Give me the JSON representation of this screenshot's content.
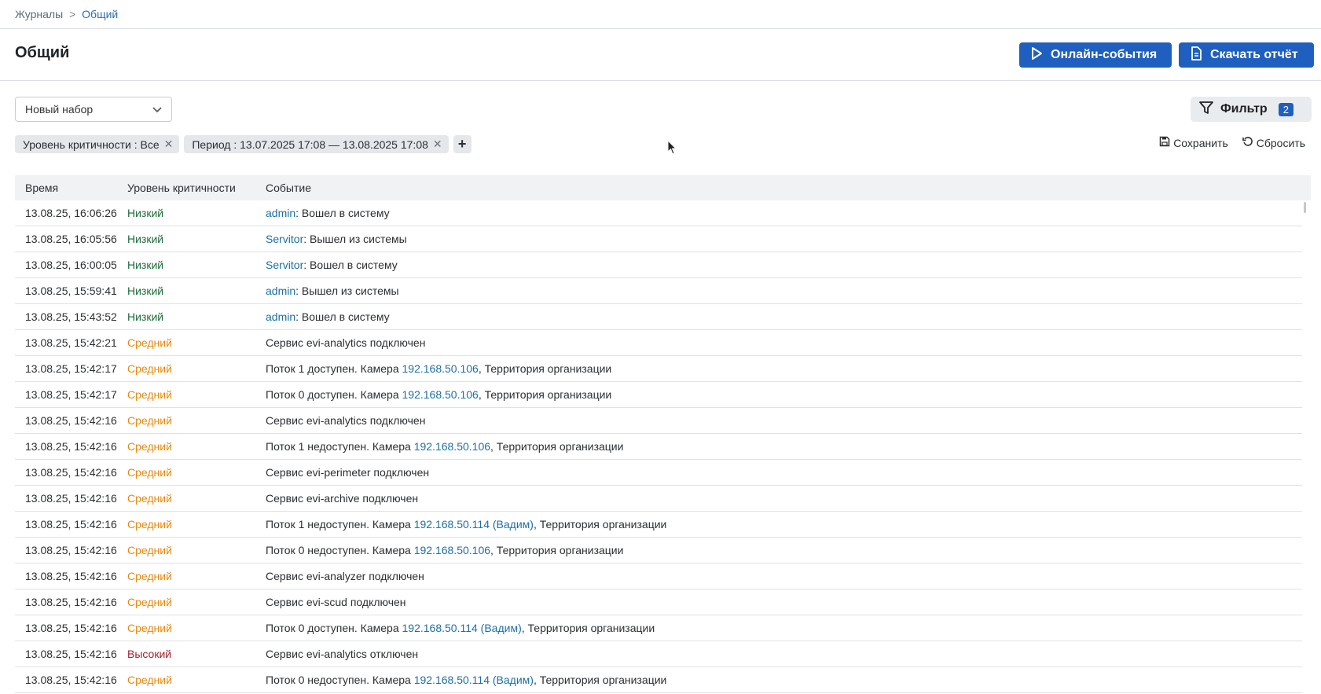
{
  "breadcrumb": {
    "root": "Журналы",
    "separator": ">",
    "current": "Общий"
  },
  "page": {
    "title": "Общий"
  },
  "toolbar": {
    "online_label": "Онлайн-события",
    "report_label": "Скачать отчёт"
  },
  "preset": {
    "value": "Новый набор"
  },
  "filter": {
    "label": "Фильтр",
    "count": "2"
  },
  "chips": [
    {
      "label": "Уровень критичности : Все"
    },
    {
      "label": "Период : 13.07.2025 17:08 — 13.08.2025 17:08"
    }
  ],
  "chip_add": "+",
  "chip_remove": "✕",
  "actions": {
    "save_label": "Сохранить",
    "reset_label": "Сбросить"
  },
  "table": {
    "headers": {
      "time": "Время",
      "level": "Уровень критичности",
      "event": "Событие"
    },
    "rows": [
      {
        "time": "13.08.25, 16:06:26",
        "level": "Низкий",
        "severity": "low",
        "event": [
          {
            "t": "admin",
            "link": true
          },
          {
            "t": ": Вошел в систему"
          }
        ]
      },
      {
        "time": "13.08.25, 16:05:56",
        "level": "Низкий",
        "severity": "low",
        "event": [
          {
            "t": "Servitor",
            "link": true
          },
          {
            "t": ": Вышел из системы"
          }
        ]
      },
      {
        "time": "13.08.25, 16:00:05",
        "level": "Низкий",
        "severity": "low",
        "event": [
          {
            "t": "Servitor",
            "link": true
          },
          {
            "t": ": Вошел в систему"
          }
        ]
      },
      {
        "time": "13.08.25, 15:59:41",
        "level": "Низкий",
        "severity": "low",
        "event": [
          {
            "t": "admin",
            "link": true
          },
          {
            "t": ": Вышел из системы"
          }
        ]
      },
      {
        "time": "13.08.25, 15:43:52",
        "level": "Низкий",
        "severity": "low",
        "event": [
          {
            "t": "admin",
            "link": true
          },
          {
            "t": ": Вошел в систему"
          }
        ]
      },
      {
        "time": "13.08.25, 15:42:21",
        "level": "Средний",
        "severity": "mid",
        "event": [
          {
            "t": "Сервис evi-analytics подключен"
          }
        ]
      },
      {
        "time": "13.08.25, 15:42:17",
        "level": "Средний",
        "severity": "mid",
        "event": [
          {
            "t": "Поток 1 доступен. Камера "
          },
          {
            "t": "192.168.50.106",
            "link": true
          },
          {
            "t": ", Территория организации"
          }
        ]
      },
      {
        "time": "13.08.25, 15:42:17",
        "level": "Средний",
        "severity": "mid",
        "event": [
          {
            "t": "Поток 0 доступен. Камера "
          },
          {
            "t": "192.168.50.106",
            "link": true
          },
          {
            "t": ", Территория организации"
          }
        ]
      },
      {
        "time": "13.08.25, 15:42:16",
        "level": "Средний",
        "severity": "mid",
        "event": [
          {
            "t": "Сервис evi-analytics подключен"
          }
        ]
      },
      {
        "time": "13.08.25, 15:42:16",
        "level": "Средний",
        "severity": "mid",
        "event": [
          {
            "t": "Поток 1 недоступен. Камера "
          },
          {
            "t": "192.168.50.106",
            "link": true
          },
          {
            "t": ", Территория организации"
          }
        ]
      },
      {
        "time": "13.08.25, 15:42:16",
        "level": "Средний",
        "severity": "mid",
        "event": [
          {
            "t": "Сервис evi-perimeter подключен"
          }
        ]
      },
      {
        "time": "13.08.25, 15:42:16",
        "level": "Средний",
        "severity": "mid",
        "event": [
          {
            "t": "Сервис evi-archive подключен"
          }
        ]
      },
      {
        "time": "13.08.25, 15:42:16",
        "level": "Средний",
        "severity": "mid",
        "event": [
          {
            "t": "Поток 1 недоступен. Камера "
          },
          {
            "t": "192.168.50.114 (Вадим)",
            "link": true
          },
          {
            "t": ", Территория организации"
          }
        ]
      },
      {
        "time": "13.08.25, 15:42:16",
        "level": "Средний",
        "severity": "mid",
        "event": [
          {
            "t": "Поток 0 недоступен. Камера "
          },
          {
            "t": "192.168.50.106",
            "link": true
          },
          {
            "t": ", Территория организации"
          }
        ]
      },
      {
        "time": "13.08.25, 15:42:16",
        "level": "Средний",
        "severity": "mid",
        "event": [
          {
            "t": "Сервис evi-analyzer подключен"
          }
        ]
      },
      {
        "time": "13.08.25, 15:42:16",
        "level": "Средний",
        "severity": "mid",
        "event": [
          {
            "t": "Сервис evi-scud подключен"
          }
        ]
      },
      {
        "time": "13.08.25, 15:42:16",
        "level": "Средний",
        "severity": "mid",
        "event": [
          {
            "t": "Поток 0 доступен. Камера "
          },
          {
            "t": "192.168.50.114 (Вадим)",
            "link": true
          },
          {
            "t": ", Территория организации"
          }
        ]
      },
      {
        "time": "13.08.25, 15:42:16",
        "level": "Высокий",
        "severity": "high",
        "event": [
          {
            "t": "Сервис evi-analytics отключен"
          }
        ]
      },
      {
        "time": "13.08.25, 15:42:16",
        "level": "Средний",
        "severity": "mid",
        "event": [
          {
            "t": "Поток 0 недоступен. Камера "
          },
          {
            "t": "192.168.50.114 (Вадим)",
            "link": true
          },
          {
            "t": ", Территория организации"
          }
        ]
      }
    ]
  },
  "colors": {
    "primary": "#1f5fbf",
    "low": "#1c6b3a",
    "mid": "#e58a0f",
    "high": "#a2222b",
    "link": "#1d6fa5"
  }
}
